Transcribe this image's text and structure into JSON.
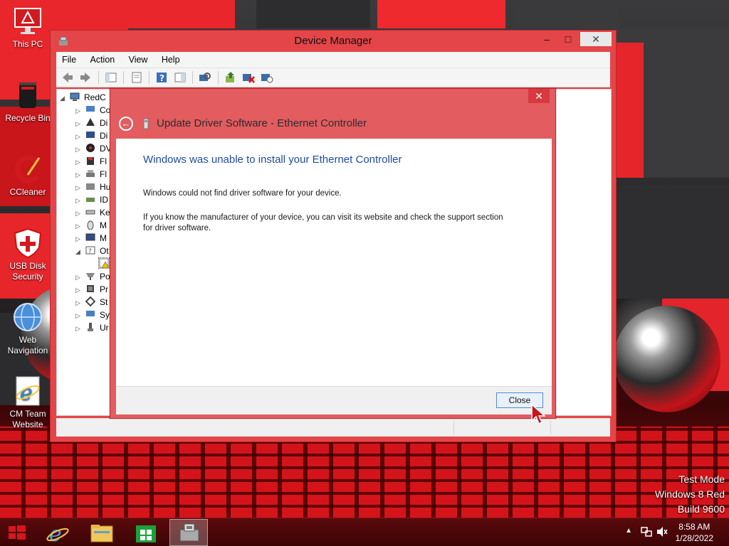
{
  "desktop": {
    "icons": [
      {
        "label": "This PC",
        "icon": "monitor-icon"
      },
      {
        "label": "Recycle Bin",
        "icon": "recycle-bin-icon"
      },
      {
        "label": "CCleaner",
        "icon": "ccleaner-icon"
      },
      {
        "label": "USB Disk Security",
        "icon": "shield-icon"
      },
      {
        "label": "Web Navigation",
        "icon": "globe-icon"
      },
      {
        "label": "CM Team Website",
        "icon": "internet-explorer-icon"
      }
    ],
    "watermark": {
      "line1": "Test Mode",
      "line2": "Windows 8 Red",
      "line3": "Build 9600"
    }
  },
  "device_manager": {
    "title": "Device Manager",
    "menu": [
      "File",
      "Action",
      "View",
      "Help"
    ],
    "tree": {
      "root": "RedC",
      "items": [
        {
          "label": "Co",
          "expanded": false
        },
        {
          "label": "Di",
          "expanded": false
        },
        {
          "label": "Di",
          "expanded": false
        },
        {
          "label": "DV",
          "expanded": false
        },
        {
          "label": "Fl",
          "expanded": false
        },
        {
          "label": "Fl",
          "expanded": false
        },
        {
          "label": "Hu",
          "expanded": false
        },
        {
          "label": "ID",
          "expanded": false
        },
        {
          "label": "Ke",
          "expanded": false
        },
        {
          "label": "M",
          "expanded": false
        },
        {
          "label": "M",
          "expanded": false
        },
        {
          "label": "Ot",
          "expanded": true
        },
        {
          "label": "",
          "child": true
        },
        {
          "label": "Po",
          "expanded": false
        },
        {
          "label": "Pr",
          "expanded": false
        },
        {
          "label": "St",
          "expanded": false
        },
        {
          "label": "Sy",
          "expanded": false
        },
        {
          "label": "Ur",
          "expanded": false
        }
      ]
    }
  },
  "dialog": {
    "title": "Update Driver Software - Ethernet Controller",
    "heading": "Windows was unable to install your Ethernet Controller",
    "paragraph1": "Windows could not find driver software for your device.",
    "paragraph2": "If you know the manufacturer of your device, you can visit its website and check the support section for driver software.",
    "close_button": "Close",
    "close_glyph": "✕"
  },
  "taskbar": {
    "items": [
      "start-icon",
      "internet-explorer-icon",
      "file-explorer-icon",
      "store-icon",
      "device-manager-icon"
    ],
    "clock": {
      "time": "8:58 AM",
      "date": "1/28/2022"
    }
  },
  "colors": {
    "accent": "#e44548",
    "dialog_frame": "#e25c60",
    "heading_blue": "#1e4c9b"
  }
}
